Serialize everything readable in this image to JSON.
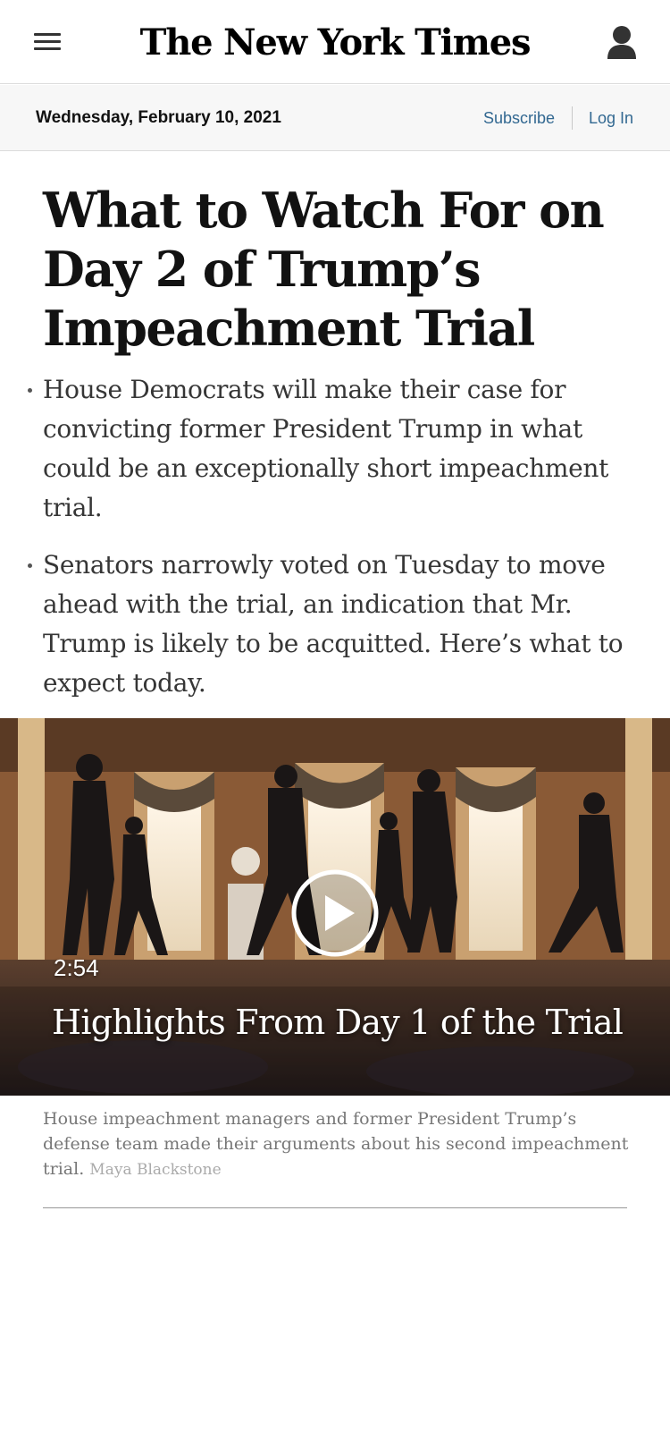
{
  "masthead": {
    "logo": "The New York Times"
  },
  "datebar": {
    "date": "Wednesday, February 10, 2021",
    "subscribe": "Subscribe",
    "login": "Log In"
  },
  "article": {
    "headline": "What to Watch For on Day 2 of Trump’s Impeachment Trial",
    "summary": [
      "House Democrats will make their case for convicting former President Trump in what could be an exceptionally short impeachment trial.",
      "Senators narrowly voted on Tuesday to move ahead with the trial, an indication that Mr. Trump is likely to be acquitted. Here’s what to expect today."
    ]
  },
  "video": {
    "duration": "2:54",
    "title": "Highlights From Day 1 of the Trial",
    "caption": "House impeachment managers and former President Trump’s defense team made their arguments about his second impeachment trial.",
    "credit": "Maya Blackstone"
  },
  "colors": {
    "link": "#326891",
    "datebar_bg": "#f7f7f7"
  }
}
